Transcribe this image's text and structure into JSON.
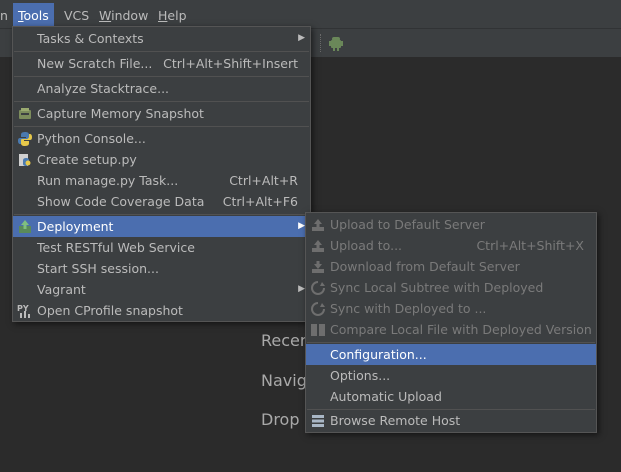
{
  "menubar": {
    "items": [
      {
        "label": "n"
      },
      {
        "label": "Tools"
      },
      {
        "label": "VCS"
      },
      {
        "label": "Window"
      },
      {
        "label": "Help"
      }
    ]
  },
  "welcome": {
    "recent": "Recen",
    "navigate": "Navig",
    "drop": "Drop"
  },
  "tools_menu": {
    "tasks_contexts": {
      "label": "Tasks & Contexts"
    },
    "new_scratch": {
      "label": "New Scratch File...",
      "shortcut": "Ctrl+Alt+Shift+Insert"
    },
    "analyze_stacktrace": {
      "label": "Analyze Stacktrace..."
    },
    "capture_memory": {
      "label": "Capture Memory Snapshot"
    },
    "python_console": {
      "label": "Python Console..."
    },
    "create_setup": {
      "label": "Create setup.py"
    },
    "run_manage": {
      "label": "Run manage.py Task...",
      "shortcut": "Ctrl+Alt+R"
    },
    "show_coverage": {
      "label": "Show Code Coverage Data",
      "shortcut": "Ctrl+Alt+F6"
    },
    "deployment": {
      "label": "Deployment"
    },
    "test_restful": {
      "label": "Test RESTful Web Service"
    },
    "start_ssh": {
      "label": "Start SSH session..."
    },
    "vagrant": {
      "label": "Vagrant"
    },
    "open_cprofile": {
      "label": "Open CProfile snapshot"
    }
  },
  "deployment_menu": {
    "upload_default": {
      "label": "Upload to Default Server"
    },
    "upload_to": {
      "label": "Upload to...",
      "shortcut": "Ctrl+Alt+Shift+X"
    },
    "download_default": {
      "label": "Download from Default Server"
    },
    "sync_local": {
      "label": "Sync Local Subtree with Deployed"
    },
    "sync_deployed": {
      "label": "Sync with Deployed to ..."
    },
    "compare_local": {
      "label": "Compare Local File with Deployed Version"
    },
    "configuration": {
      "label": "Configuration..."
    },
    "options": {
      "label": "Options..."
    },
    "automatic_upload": {
      "label": "Automatic Upload"
    },
    "browse_remote": {
      "label": "Browse Remote Host"
    }
  },
  "colors": {
    "background": "#2b2b2b",
    "menu_bg": "#3c3f41",
    "highlight": "#4b6eaf",
    "text": "#bbbbbb",
    "disabled_text": "#7a7a7a"
  },
  "icons": [
    "android-run-icon",
    "memory-snapshot-icon",
    "python-icon",
    "setup-py-icon",
    "deployment-icon",
    "cprofile-icon",
    "upload-icon",
    "download-icon",
    "sync-icon",
    "compare-icon",
    "browse-remote-icon"
  ]
}
